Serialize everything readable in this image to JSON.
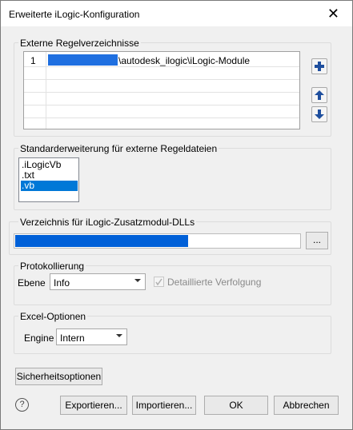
{
  "window": {
    "title": "Erweiterte iLogic-Konfiguration"
  },
  "external_rules": {
    "group_label": "Externe Regelverzeichnisse",
    "rows": [
      {
        "num": "1",
        "path": "\\autodesk_ilogic\\iLogic-Module"
      }
    ]
  },
  "extensions": {
    "group_label": "Standarderweiterung für externe Regeldateien",
    "items": [
      ".iLogicVb",
      ".txt",
      ".vb"
    ],
    "selected": ".vb"
  },
  "addin_dir": {
    "group_label": "Verzeichnis für iLogic-Zusatzmodul-DLLs",
    "browse_label": "..."
  },
  "logging": {
    "group_label": "Protokollierung",
    "level_label": "Ebene",
    "level_value": "Info",
    "detailed_trace_label": "Detaillierte Verfolgung"
  },
  "excel": {
    "group_label": "Excel-Optionen",
    "engine_label": "Engine",
    "engine_value": "Intern"
  },
  "buttons": {
    "security": "Sicherheitsoptionen",
    "export": "Exportieren...",
    "import": "Importieren...",
    "ok": "OK",
    "cancel": "Abbrechen"
  },
  "icons": {
    "help": "?",
    "close": "✕",
    "add": "plus-icon",
    "up": "arrow-up-icon",
    "down": "arrow-down-icon"
  },
  "colors": {
    "accent": "#0078d7",
    "icon_blue": "#1f4f9e"
  }
}
